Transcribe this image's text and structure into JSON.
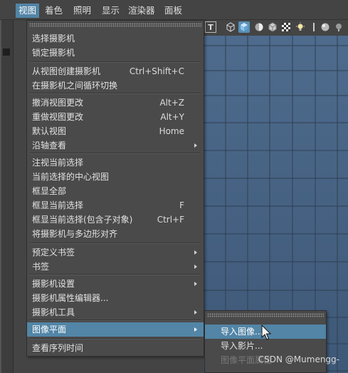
{
  "menubar": {
    "items": [
      "视图",
      "着色",
      "照明",
      "显示",
      "渲染器",
      "面板"
    ],
    "active_index": 0
  },
  "viewport_toolbar": {
    "icons": [
      "text-tool-icon",
      "wireframe-cube-icon",
      "shaded-cube-icon",
      "smooth-shade-icon",
      "textured-cube-icon",
      "checker-icon",
      "light-bulb-icon",
      "shadow-icon",
      "sphere-icon",
      "sphere-small-icon"
    ],
    "selected_index": 2,
    "text_icon_label": "T"
  },
  "main_menu": {
    "items": [
      {
        "label": "选择摄影机",
        "shortcut": "",
        "submenu": false
      },
      {
        "label": "锁定摄影机",
        "shortcut": "",
        "submenu": false
      },
      {
        "label": "从视图创建摄影机",
        "shortcut": "Ctrl+Shift+C",
        "submenu": false
      },
      {
        "label": "在摄影机之间循环切换",
        "shortcut": "",
        "submenu": false
      },
      {
        "label": "撤消视图更改",
        "shortcut": "Alt+Z",
        "submenu": false
      },
      {
        "label": "重做视图更改",
        "shortcut": "Alt+Y",
        "submenu": false
      },
      {
        "label": "默认视图",
        "shortcut": "Home",
        "submenu": false
      },
      {
        "label": "沿轴查看",
        "shortcut": "",
        "submenu": true
      },
      {
        "label": "注视当前选择",
        "shortcut": "",
        "submenu": false
      },
      {
        "label": "当前选择的中心视图",
        "shortcut": "",
        "submenu": false
      },
      {
        "label": "框显全部",
        "shortcut": "",
        "submenu": false
      },
      {
        "label": "框显当前选择",
        "shortcut": "F",
        "submenu": false
      },
      {
        "label": "框显当前选择(包含子对象)",
        "shortcut": "Ctrl+F",
        "submenu": false
      },
      {
        "label": "将摄影机与多边形对齐",
        "shortcut": "",
        "submenu": false
      },
      {
        "label": "预定义书签",
        "shortcut": "",
        "submenu": true
      },
      {
        "label": "书签",
        "shortcut": "",
        "submenu": true
      },
      {
        "label": "摄影机设置",
        "shortcut": "",
        "submenu": true
      },
      {
        "label": "摄影机属性编辑器...",
        "shortcut": "",
        "submenu": false
      },
      {
        "label": "摄影机工具",
        "shortcut": "",
        "submenu": true
      },
      {
        "label": "图像平面",
        "shortcut": "",
        "submenu": true
      },
      {
        "label": "查看序列时间",
        "shortcut": "",
        "submenu": false
      }
    ],
    "highlighted_index": 19
  },
  "submenu": {
    "items": [
      {
        "label": "导入图像...",
        "enabled": true
      },
      {
        "label": "导入影片...",
        "enabled": true
      },
      {
        "label": "图像平面属性",
        "enabled": false
      }
    ],
    "highlighted_index": 0
  },
  "watermark": "CSDN @Mumengg-",
  "colors": {
    "highlight": "#5285a6",
    "menu_bg": "#4a4a4a",
    "viewport_top": "#4e6b8d",
    "viewport_bottom": "#3e5877"
  }
}
